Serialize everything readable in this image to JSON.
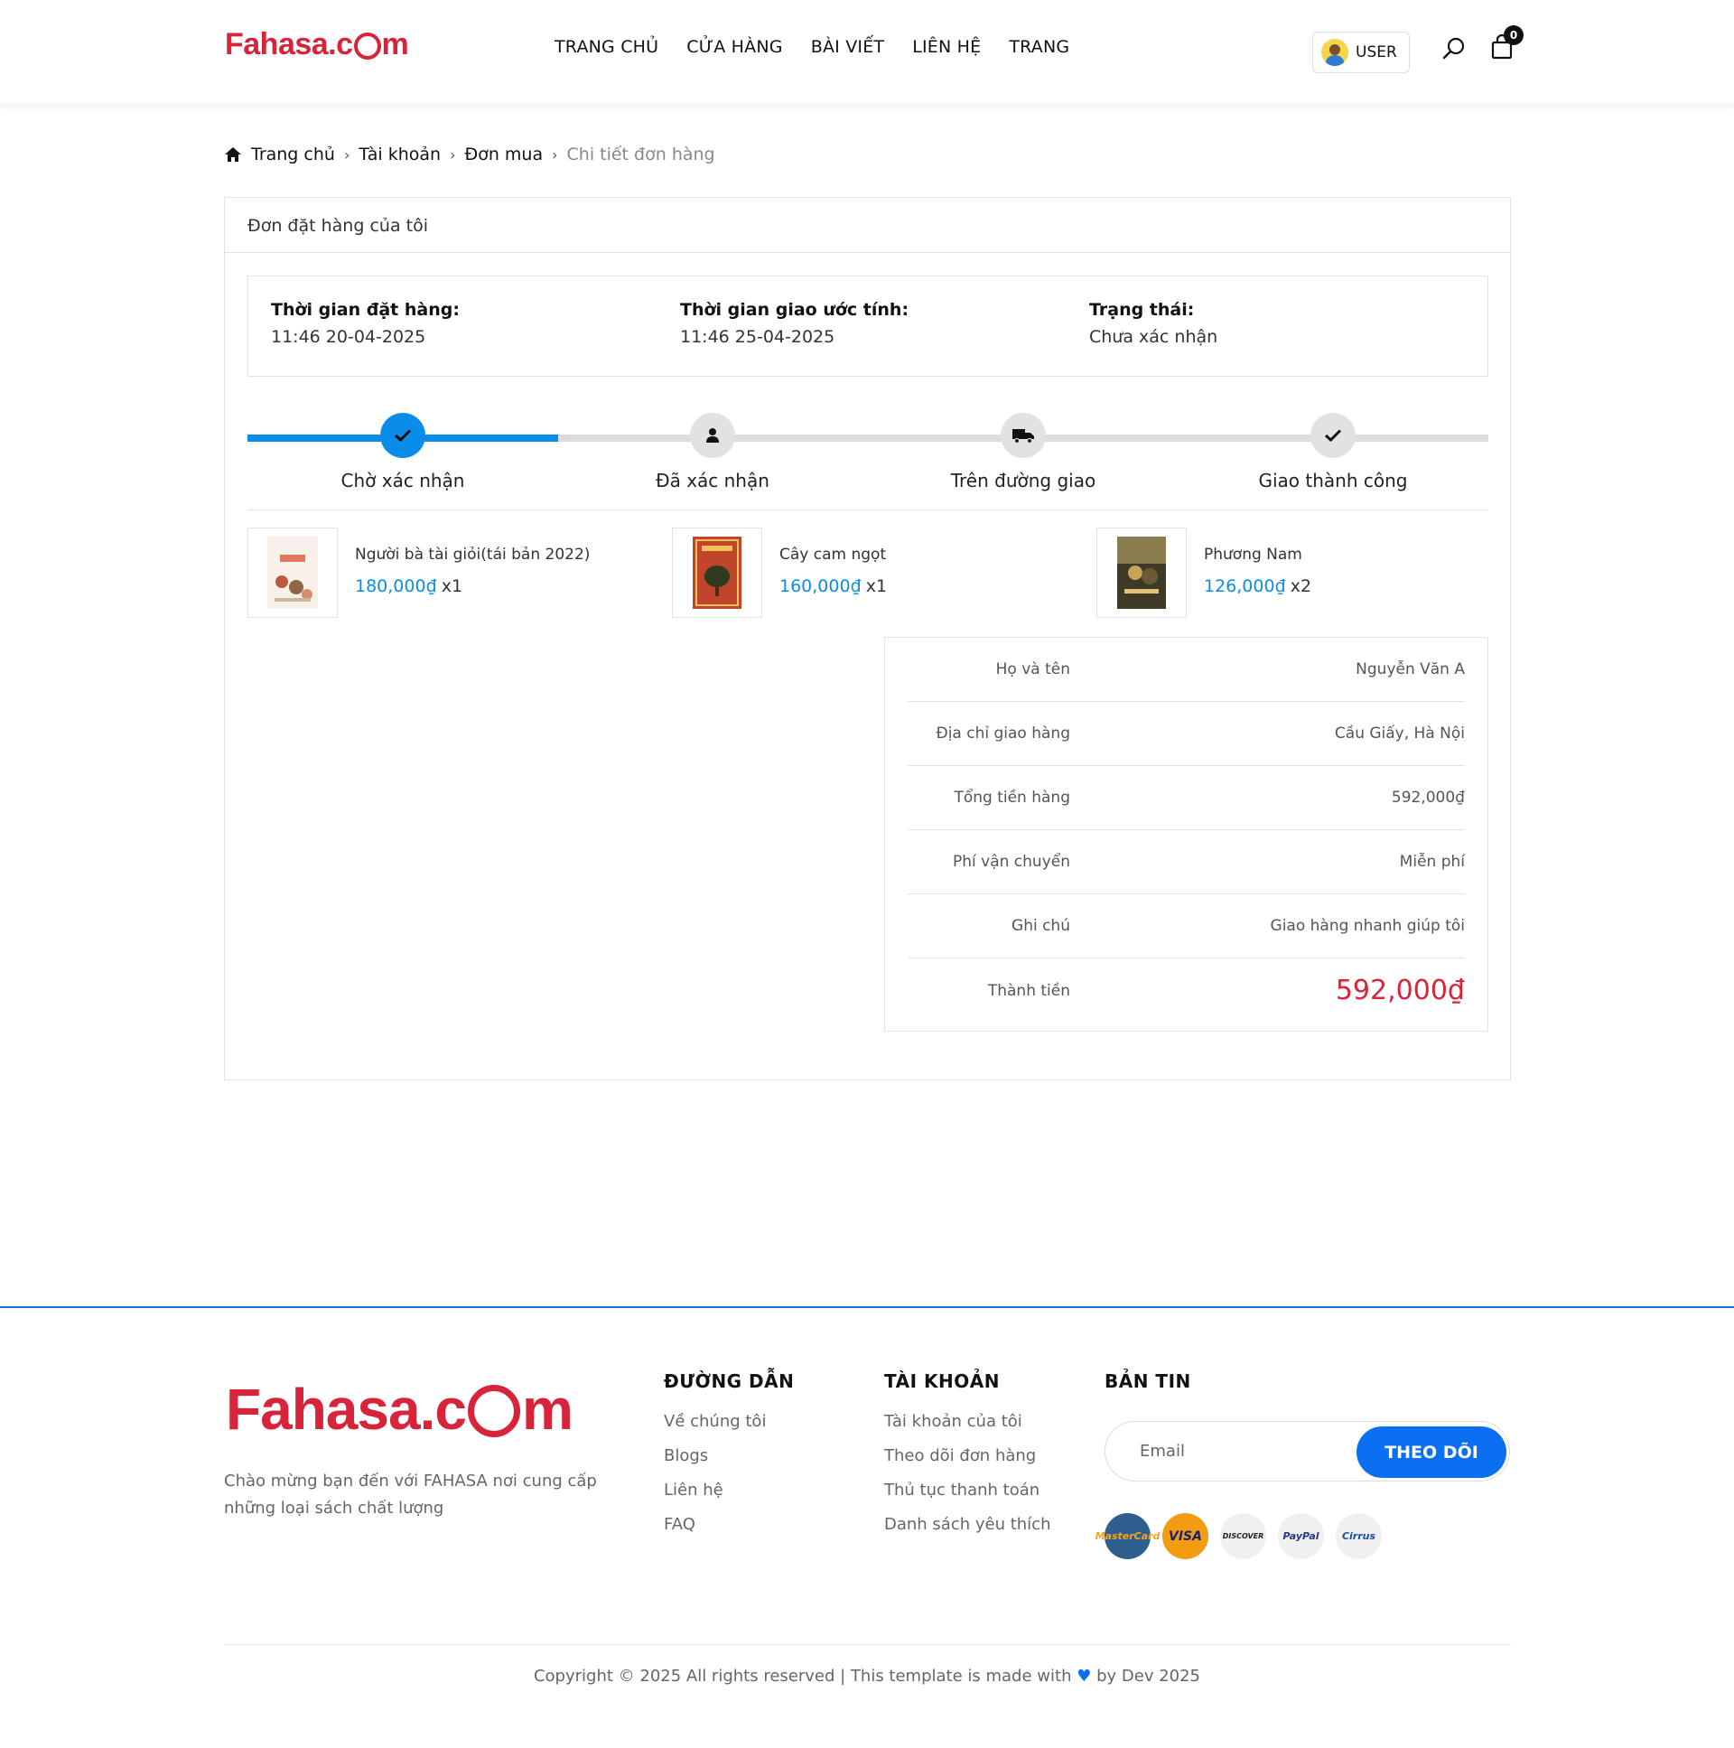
{
  "header": {
    "logo": "Fahasa.com",
    "nav": [
      "TRANG CHỦ",
      "CỬA HÀNG",
      "BÀI VIẾT",
      "LIÊN HỆ",
      "TRANG"
    ],
    "user_label": "USER",
    "cart_count": "0"
  },
  "breadcrumb": {
    "items": [
      "Trang chủ",
      "Tài khoản",
      "Đơn mua"
    ],
    "current": "Chi tiết đơn hàng"
  },
  "order": {
    "title": "Đơn đặt hàng của tôi",
    "placed_label": "Thời gian đặt hàng:",
    "placed_value": "11:46 20-04-2025",
    "eta_label": "Thời gian giao ước tính:",
    "eta_value": "11:46 25-04-2025",
    "status_label": "Trạng thái:",
    "status_value": "Chưa xác nhận",
    "progress_fraction": 0.25,
    "steps": [
      {
        "label": "Chờ xác nhận",
        "icon": "check-icon",
        "active": true
      },
      {
        "label": "Đã xác nhận",
        "icon": "user-icon",
        "active": false
      },
      {
        "label": "Trên đường giao",
        "icon": "truck-icon",
        "active": false
      },
      {
        "label": "Giao thành công",
        "icon": "check-icon",
        "active": false
      }
    ],
    "products": [
      {
        "name": "Người bà tài giỏi(tái bản 2022)",
        "price": "180,000₫",
        "qty": "x1"
      },
      {
        "name": "Cây cam ngọt",
        "price": "160,000₫",
        "qty": "x1"
      },
      {
        "name": "Phương Nam",
        "price": "126,000₫",
        "qty": "x2"
      }
    ],
    "summary": [
      {
        "label": "Họ và tên",
        "value": "Nguyễn Văn A"
      },
      {
        "label": "Địa chỉ giao hàng",
        "value": "Cầu Giấy, Hà Nội"
      },
      {
        "label": "Tổng tiền hàng",
        "value": "592,000₫"
      },
      {
        "label": "Phí vận chuyển",
        "value": "Miễn phí"
      },
      {
        "label": "Ghi chú",
        "value": "Giao hàng nhanh giúp tôi"
      },
      {
        "label": "Thành tiền",
        "value": "592,000₫"
      }
    ]
  },
  "footer": {
    "logo": "Fahasa.com",
    "description": "Chào mừng bạn đến với FAHASA nơi cung cấp những loại sách chất lượng",
    "links_title": "ĐƯỜNG DẪN",
    "links": [
      "Về chúng tôi",
      "Blogs",
      "Liên hệ",
      "FAQ"
    ],
    "account_title": "TÀI KHOẢN",
    "account_links": [
      "Tài khoản của tôi",
      "Theo dõi đơn hàng",
      "Thủ tục thanh toán",
      "Danh sách yêu thích"
    ],
    "newsletter_title": "BẢN TIN",
    "email_placeholder": "Email",
    "subscribe_label": "THEO DÕI",
    "payments": [
      "MasterCard",
      "VISA",
      "DISCOVER",
      "PayPal",
      "Cirrus"
    ],
    "copyright_left": "Copyright © 2025 All rights reserved | This template is made with",
    "copyright_right": "by Dev 2025"
  },
  "colors": {
    "brand_red": "#d7243a",
    "accent_blue": "#0a8de8",
    "button_blue": "#0a6ff0"
  }
}
